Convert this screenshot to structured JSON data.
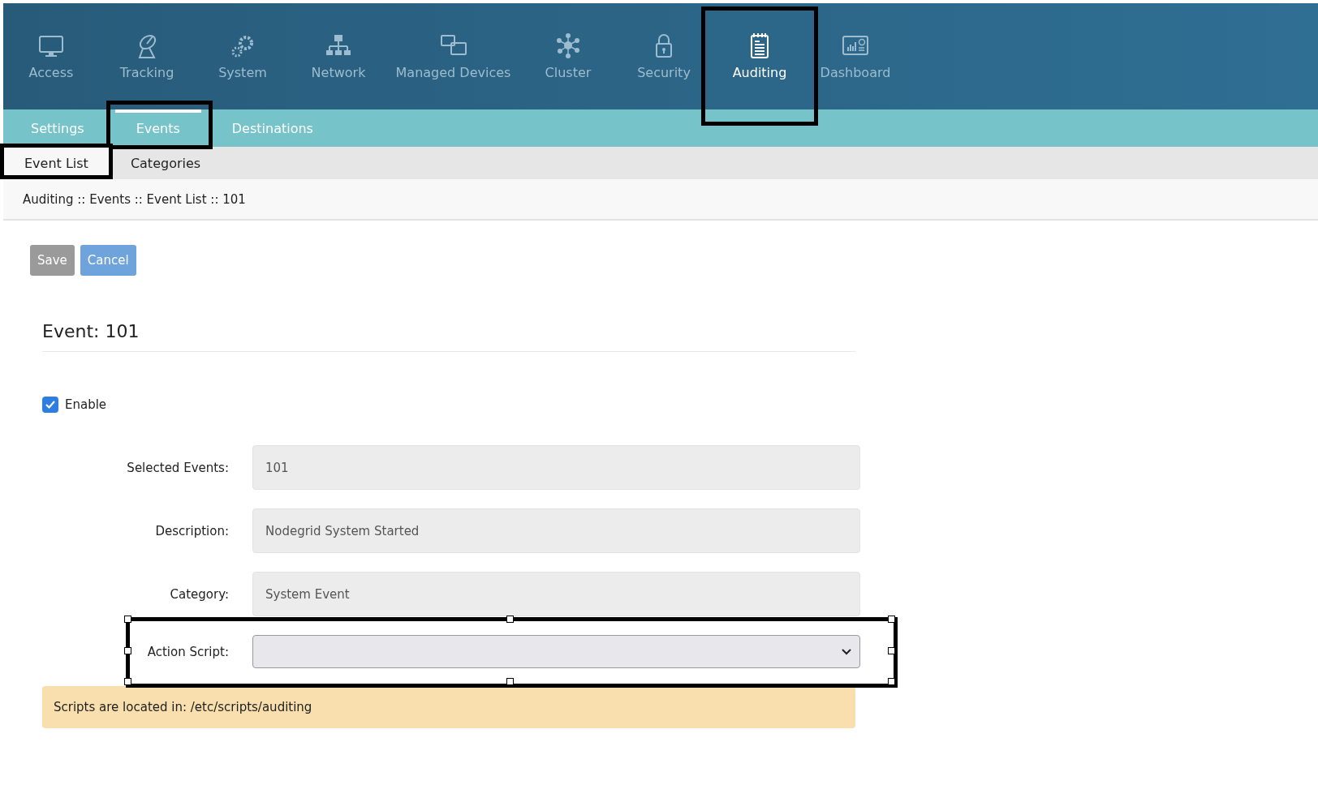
{
  "nav": {
    "items": [
      {
        "label": "Access",
        "selected": false,
        "highlighted": false
      },
      {
        "label": "Tracking",
        "selected": false,
        "highlighted": false
      },
      {
        "label": "System",
        "selected": false,
        "highlighted": false
      },
      {
        "label": "Network",
        "selected": false,
        "highlighted": false
      },
      {
        "label": "Managed Devices",
        "selected": false,
        "highlighted": false
      },
      {
        "label": "Cluster",
        "selected": false,
        "highlighted": false
      },
      {
        "label": "Security",
        "selected": false,
        "highlighted": false
      },
      {
        "label": "Auditing",
        "selected": true,
        "highlighted": true
      },
      {
        "label": "Dashboard",
        "selected": false,
        "highlighted": false
      }
    ]
  },
  "tabs": [
    {
      "label": "Settings",
      "selected": false,
      "highlighted": false
    },
    {
      "label": "Events",
      "selected": true,
      "highlighted": true
    },
    {
      "label": "Destinations",
      "selected": false,
      "highlighted": false
    }
  ],
  "subtabs": [
    {
      "label": "Event List",
      "selected": true,
      "highlighted": true
    },
    {
      "label": "Categories",
      "selected": false,
      "highlighted": false
    }
  ],
  "breadcrumb": "Auditing :: Events :: Event List :: 101",
  "buttons": [
    {
      "label": "Save",
      "disabled": true
    },
    {
      "label": "Cancel",
      "disabled": false
    }
  ],
  "title": "Event: 101",
  "enable": {
    "label": "Enable",
    "checked": true
  },
  "fields": [
    {
      "label": "Selected Events:",
      "kind": "readonly",
      "value": "101",
      "highlighted": false
    },
    {
      "label": "Description:",
      "kind": "readonly",
      "value": "Nodegrid System Started",
      "highlighted": false
    },
    {
      "label": "Category:",
      "kind": "readonly",
      "value": "System Event",
      "highlighted": false
    },
    {
      "label": "Action Script:",
      "kind": "select",
      "highlighted": true
    }
  ],
  "note": "Scripts are located in: /etc/scripts/auditing"
}
